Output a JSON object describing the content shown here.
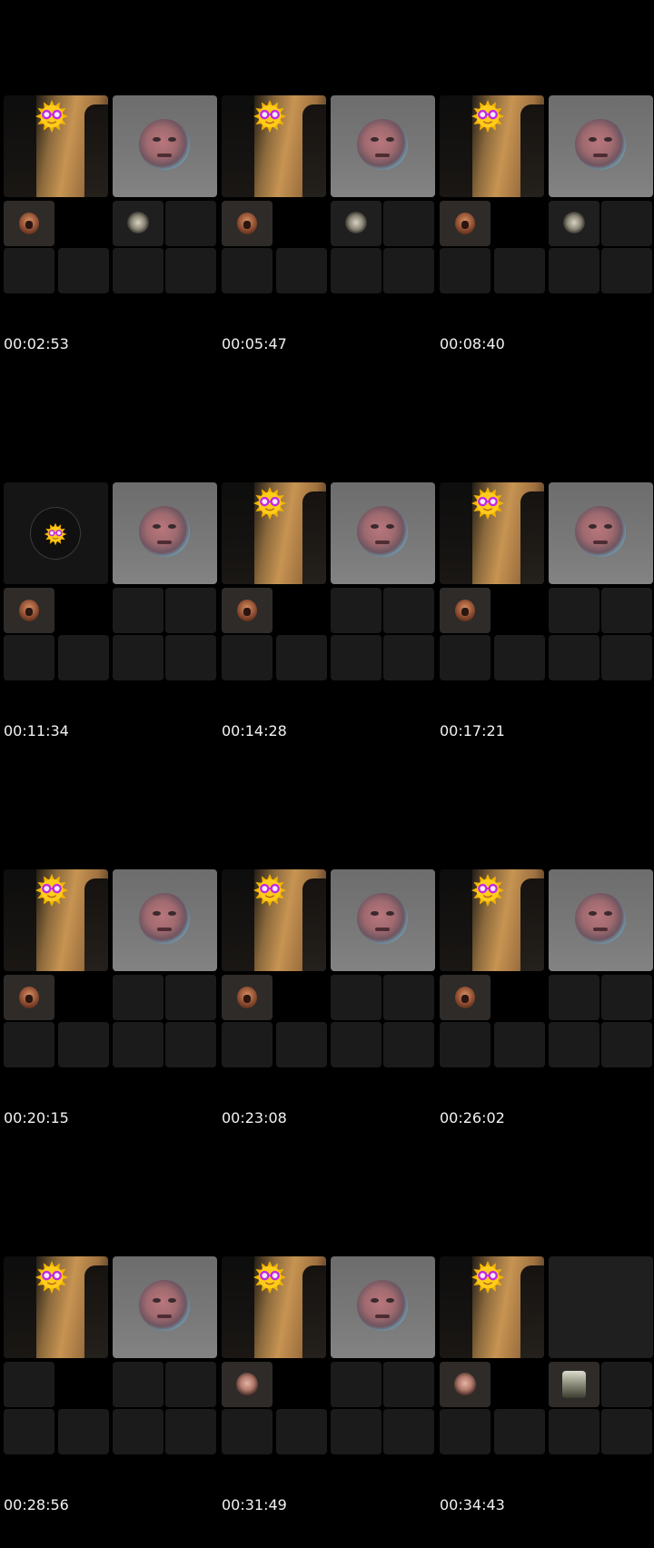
{
  "grid_title": "",
  "thumbnails": [
    {
      "timestamp": "00:02:53",
      "main_tile": "camera",
      "secondary_tile": "profile-face",
      "small_tiles": [
        "avatar-ball",
        "blank",
        "avatar-gear",
        "dark"
      ]
    },
    {
      "timestamp": "00:05:47",
      "main_tile": "camera",
      "secondary_tile": "profile-face",
      "small_tiles": [
        "avatar-ball",
        "blank",
        "avatar-gear",
        "dark"
      ]
    },
    {
      "timestamp": "00:08:40",
      "main_tile": "camera",
      "secondary_tile": "profile-face",
      "small_tiles": [
        "avatar-ball",
        "blank",
        "avatar-gear",
        "dark"
      ]
    },
    {
      "timestamp": "00:11:34",
      "main_tile": "camera-off",
      "secondary_tile": "profile-face",
      "small_tiles": [
        "avatar-ball",
        "blank",
        "dark",
        "dark"
      ]
    },
    {
      "timestamp": "00:14:28",
      "main_tile": "camera",
      "secondary_tile": "profile-face",
      "small_tiles": [
        "avatar-ball",
        "blank",
        "dark",
        "dark"
      ]
    },
    {
      "timestamp": "00:17:21",
      "main_tile": "camera",
      "secondary_tile": "profile-face",
      "small_tiles": [
        "avatar-ball",
        "blank",
        "dark",
        "dark"
      ]
    },
    {
      "timestamp": "00:20:15",
      "main_tile": "camera",
      "secondary_tile": "profile-face",
      "small_tiles": [
        "avatar-ball",
        "blank",
        "dark",
        "dark"
      ]
    },
    {
      "timestamp": "00:23:08",
      "main_tile": "camera",
      "secondary_tile": "profile-face",
      "small_tiles": [
        "avatar-ball",
        "blank",
        "dark",
        "dark"
      ]
    },
    {
      "timestamp": "00:26:02",
      "main_tile": "camera",
      "secondary_tile": "profile-face",
      "small_tiles": [
        "avatar-ball",
        "blank",
        "dark",
        "dark"
      ]
    },
    {
      "timestamp": "00:28:56",
      "main_tile": "camera",
      "secondary_tile": "profile-face",
      "small_tiles": [
        "dark",
        "blank",
        "dark",
        "dark"
      ]
    },
    {
      "timestamp": "00:31:49",
      "main_tile": "camera",
      "secondary_tile": "profile-face",
      "small_tiles": [
        "avatar-girl",
        "blank",
        "dark",
        "dark"
      ]
    },
    {
      "timestamp": "00:34:43",
      "main_tile": "camera",
      "secondary_tile": "empty",
      "small_tiles": [
        "avatar-girl",
        "blank",
        "avatar-guy",
        "dark"
      ]
    }
  ],
  "colors": {
    "background": "#000000",
    "tile": "#1b1b1b",
    "timestamp_text": "#f2f2f2"
  },
  "icons": [
    "sun-sticker-icon",
    "profile-face-icon",
    "avatar-icon"
  ]
}
